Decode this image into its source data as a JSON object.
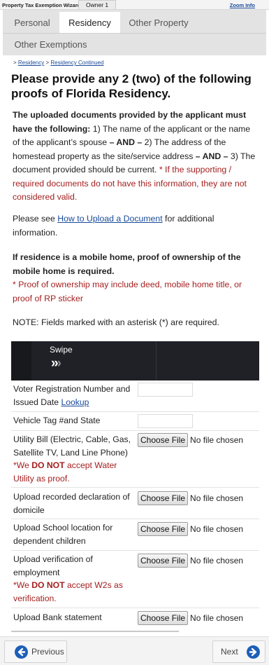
{
  "topbar": {
    "wizard_title": "Property Tax Exemption Wizard -",
    "owner_tab": "Owner 1",
    "zoom_link": "Zoom Info"
  },
  "tabs": [
    {
      "label": "Personal",
      "active": false
    },
    {
      "label": "Residency",
      "active": true
    },
    {
      "label": "Other Property",
      "active": false
    },
    {
      "label": "Other Exemptions",
      "active": false
    }
  ],
  "breadcrumb": {
    "prefix": ">",
    "item1": "Residency",
    "sep": ">",
    "item2": "Residency Continued"
  },
  "heading": "Please provide any 2 (two) of the following proofs of Florida Residency.",
  "intro": {
    "bold1": "The uploaded documents provided by the applicant must have the following:",
    "t1": " 1) The name of the applicant or the name of the applicant’s spouse ",
    "and1": "– AND –",
    "t2": " 2) The address of the homestead property as the site/service address ",
    "and2": "– AND –",
    "t3": " 3) The document provided should be current. ",
    "red": "* If the supporting / required documents do not have this information, they are not considered valid."
  },
  "upload_help": {
    "pre": "Please see ",
    "link": "How to Upload a Document",
    "post": " for additional information."
  },
  "mobile_home": {
    "bold": "If residence is a mobile home, proof of ownership of the mobile home is required.",
    "red": "* Proof of ownership may include deed, mobile home title, or proof of RP sticker"
  },
  "note": "NOTE: Fields marked with an asterisk (*) are required.",
  "table": {
    "swipe_label": "Swipe",
    "swipe_icon": "chevrons-right-icon",
    "rows": [
      {
        "label": "Voter Registration Number and Issued Date ",
        "link": "Lookup"
      },
      {
        "label": "Vehicle Tag #and State"
      },
      {
        "label": "Utility Bill (Electric, Cable, Gas, Satellite TV, Land Line Phone)",
        "note_pre": "*We ",
        "note_bold": "DO NOT",
        "note_post": " accept Water Utility as proof."
      },
      {
        "label": "Upload recorded declaration of domicile"
      },
      {
        "label": "Upload School location for dependent children"
      },
      {
        "label": "Upload verification of employment",
        "note_pre": "*We ",
        "note_bold": "DO NOT",
        "note_post": " accept W2s as verification."
      },
      {
        "label": "Upload Bank statement"
      }
    ],
    "choose_file": "Choose File",
    "no_file": "No file chosen"
  },
  "nav": {
    "previous": "Previous",
    "next": "Next"
  },
  "colors": {
    "link": "#1a4a9a",
    "warning_red": "#a41e1e",
    "header_dark": "#1f2126",
    "nav_icon_blue": "#1d5fb8"
  }
}
